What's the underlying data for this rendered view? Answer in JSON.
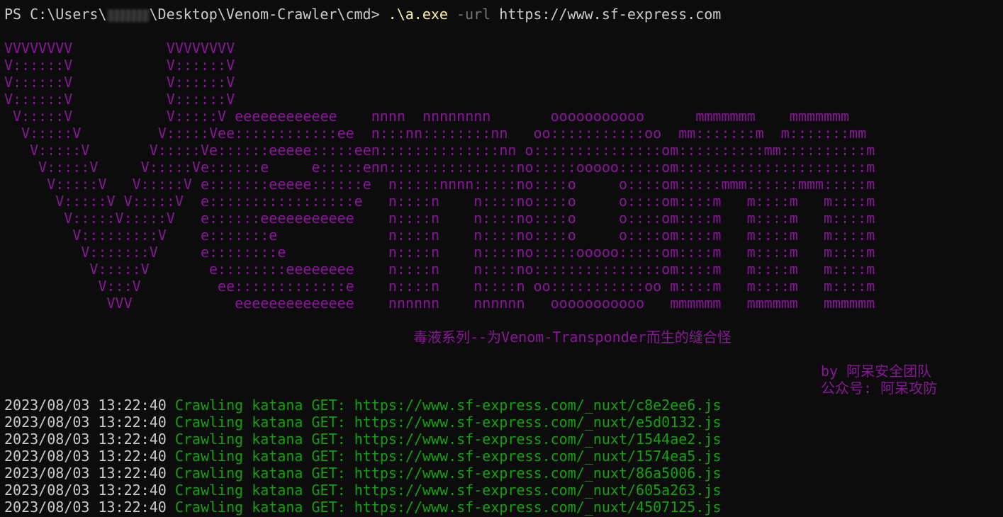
{
  "prompt": {
    "prefix": "PS C:\\Users\\",
    "suffix": "\\Desktop\\Venom-Crawler\\cmd> ",
    "exe": ".\\a.exe",
    "flag": " -url ",
    "url": "https://www.sf-express.com"
  },
  "banner": {
    "lines": [
      "VVVVVVVV           VVVVVVVV",
      "V::::::V           V::::::V",
      "V::::::V           V::::::V",
      "V::::::V           V::::::V",
      " V:::::V           V:::::V eeeeeeeeeeee    nnnn  nnnnnnnn       ooooooooooo      mmmmmmm    mmmmmmm",
      "  V:::::V         V:::::Vee::::::::::::ee  n:::nn::::::::nn   oo:::::::::::oo  mm:::::::m  m:::::::mm",
      "   V:::::V       V:::::Ve::::::eeeee:::::een::::::::::::::nn o:::::::::::::::om::::::::::mm::::::::::m",
      "    V:::::V     V:::::Ve::::::e     e:::::enn:::::::::::::::no:::::ooooo:::::om::::::::::::::::::::::m",
      "     V:::::V   V:::::V e:::::::eeeee::::::e  n:::::nnnn:::::no::::o     o::::om:::::mmm::::::mmm:::::m",
      "      V:::::V V:::::V  e:::::::::::::::::e   n::::n    n::::no::::o     o::::om::::m   m::::m   m::::m",
      "       V:::::V:::::V   e::::::eeeeeeeeeee    n::::n    n::::no::::o     o::::om::::m   m::::m   m::::m",
      "        V:::::::::V    e:::::::e             n::::n    n::::no::::o     o::::om::::m   m::::m   m::::m",
      "         V:::::::V     e::::::::e            n::::n    n::::no:::::ooooo:::::om::::m   m::::m   m::::m",
      "          V:::::V       e::::::::eeeeeeee    n::::n    n::::no:::::::::::::::om::::m   m::::m   m::::m",
      "           V:::V         ee:::::::::::::e    n::::n    n::::n oo:::::::::::oo m::::m   m::::m   m::::m",
      "            VVV            eeeeeeeeeeeeee    nnnnnn    nnnnnn   ooooooooooo   mmmmmm   mmmmmm   mmmmmm"
    ]
  },
  "subtitle": "毒液系列--为Venom-Transponder而生的缝合怪",
  "credits": {
    "by": "by 阿呆安全团队",
    "wechat": "公众号: 阿呆攻防"
  },
  "logs": [
    {
      "timestamp": "2023/08/03 13:22:40",
      "message": "Crawling katana GET: https://www.sf-express.com/_nuxt/c8e2ee6.js"
    },
    {
      "timestamp": "2023/08/03 13:22:40",
      "message": "Crawling katana GET: https://www.sf-express.com/_nuxt/e5d0132.js"
    },
    {
      "timestamp": "2023/08/03 13:22:40",
      "message": "Crawling katana GET: https://www.sf-express.com/_nuxt/1544ae2.js"
    },
    {
      "timestamp": "2023/08/03 13:22:40",
      "message": "Crawling katana GET: https://www.sf-express.com/_nuxt/1574ea5.js"
    },
    {
      "timestamp": "2023/08/03 13:22:40",
      "message": "Crawling katana GET: https://www.sf-express.com/_nuxt/86a5006.js"
    },
    {
      "timestamp": "2023/08/03 13:22:40",
      "message": "Crawling katana GET: https://www.sf-express.com/_nuxt/605a263.js"
    },
    {
      "timestamp": "2023/08/03 13:22:40",
      "message": "Crawling katana GET: https://www.sf-express.com/_nuxt/4507125.js"
    }
  ],
  "colors": {
    "background": "#0c0c0c",
    "foreground": "#cccccc",
    "banner": "#881798",
    "log_message": "#13a10e",
    "command_exe": "#f9f1a5",
    "command_flag": "#767676"
  }
}
